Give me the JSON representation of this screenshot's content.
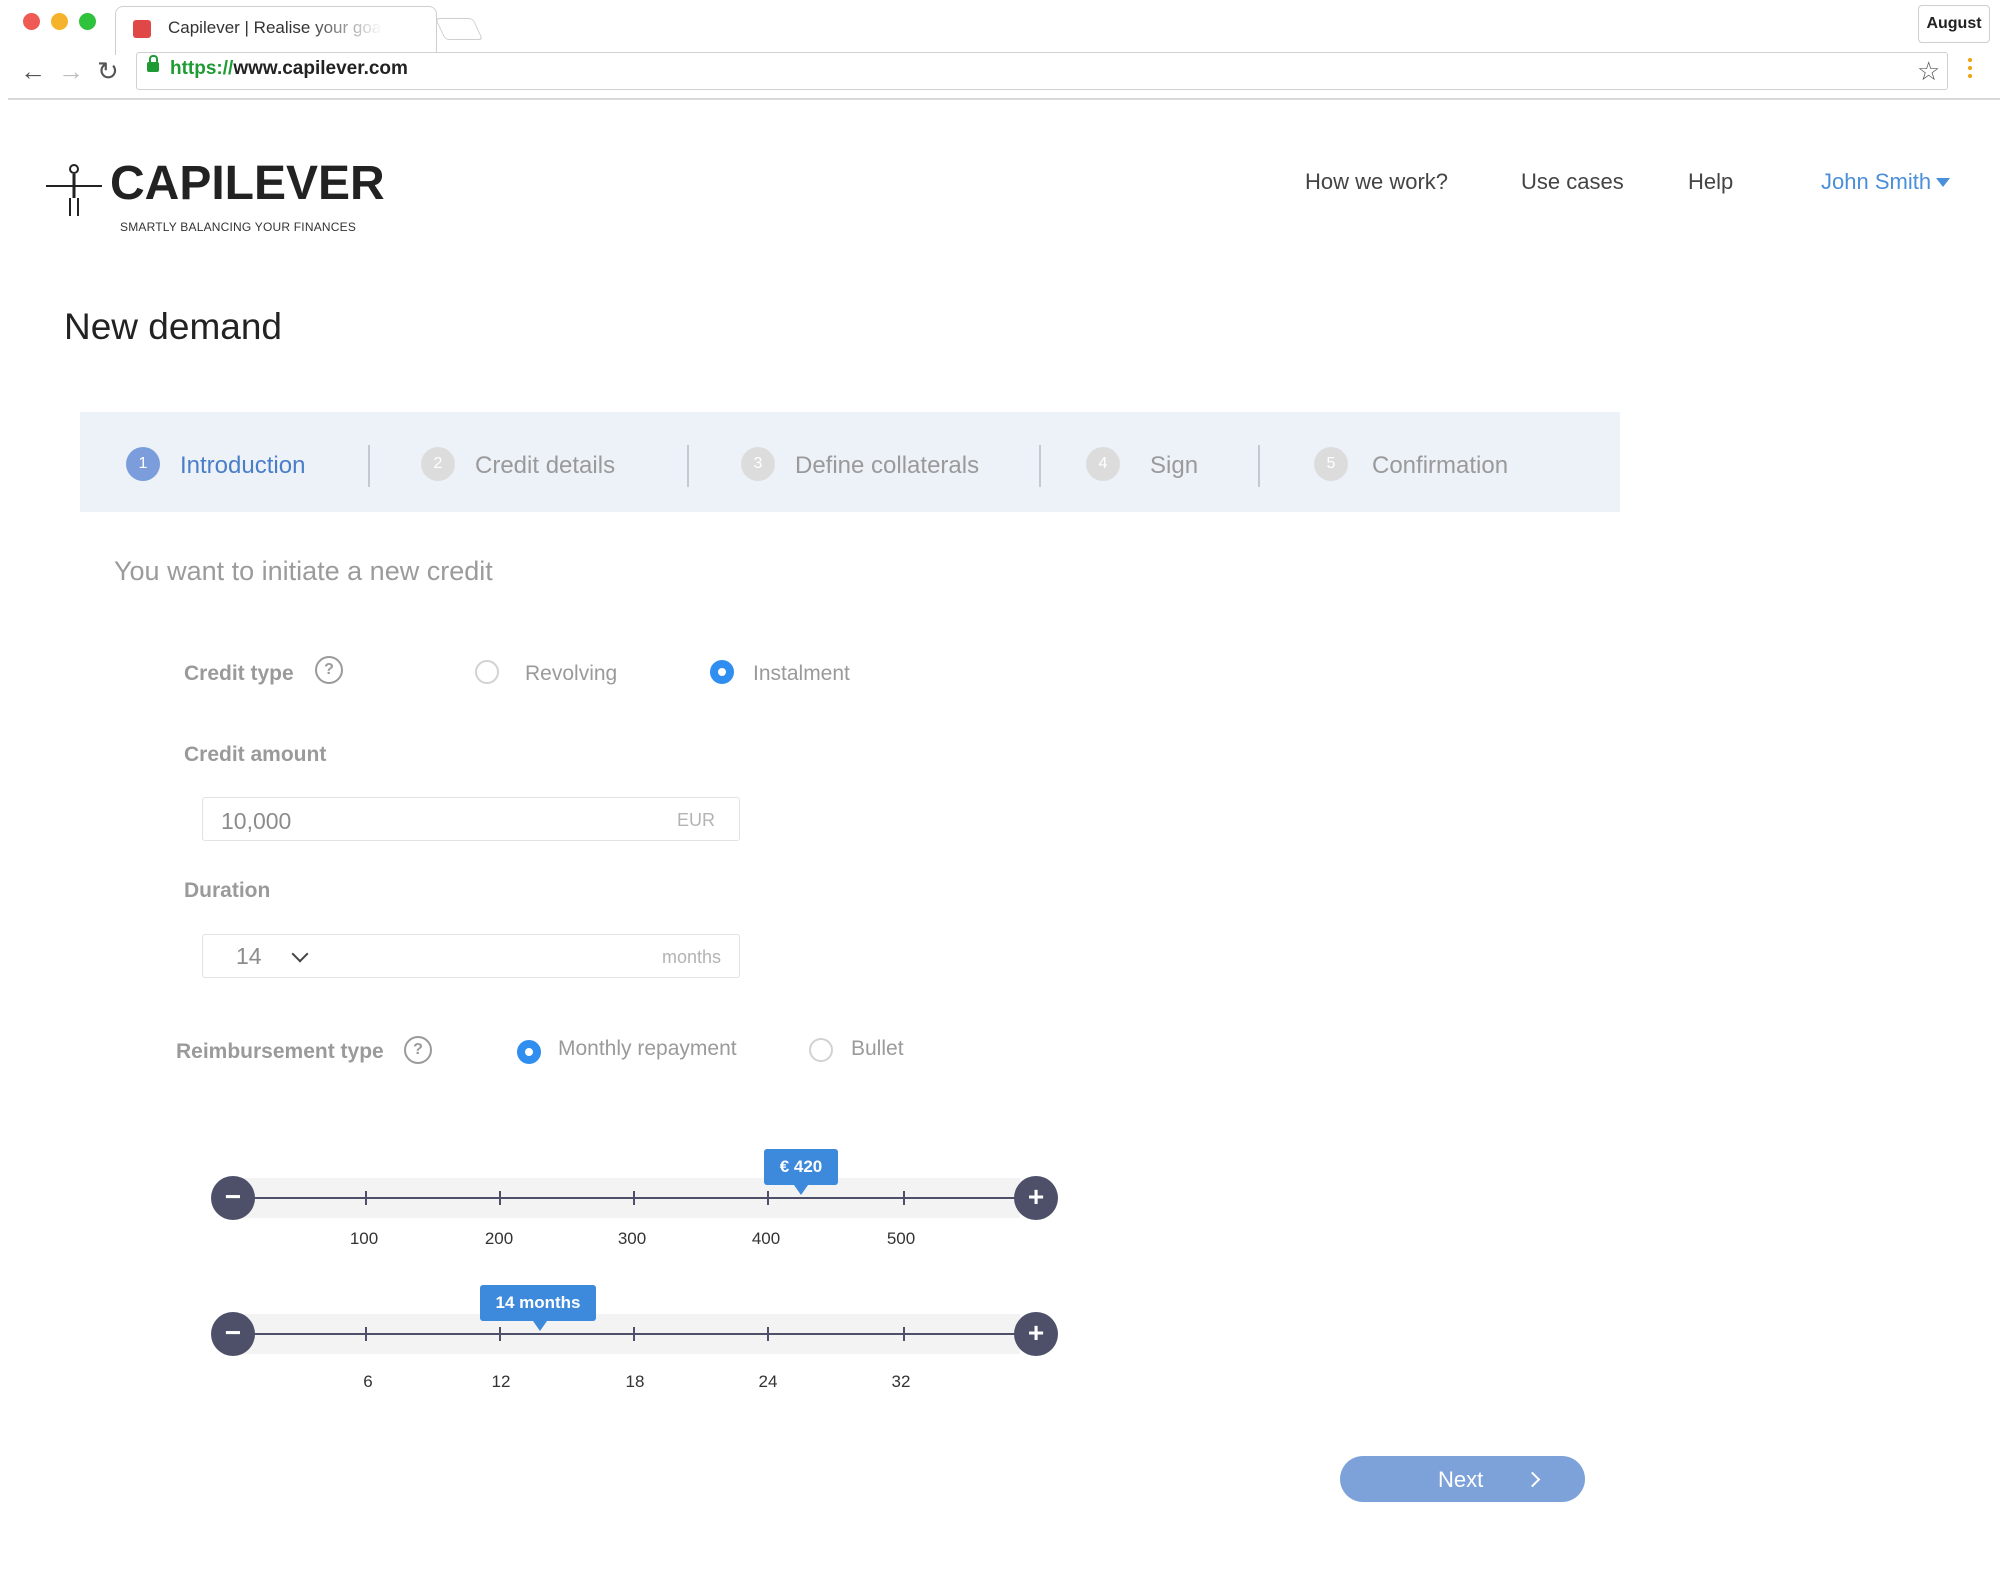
{
  "browser": {
    "tab_title": "Capilever | Realise your goa",
    "url_scheme": "https://",
    "url_host": "www.capilever.com",
    "profile_label": "August",
    "traffic_lights": [
      "#ef5a54",
      "#f5b32b",
      "#2fc23c"
    ]
  },
  "header": {
    "logo_text": "CAPILEVER",
    "logo_tagline": "SMARTLY BALANCING YOUR FINANCES",
    "nav": [
      "How we work?",
      "Use cases",
      "Help"
    ],
    "user_name": "John Smith",
    "accent_color": "#4a8fd9"
  },
  "page": {
    "title": "New demand",
    "subtitle": "You want to initiate a new credit"
  },
  "stepper": {
    "steps": [
      {
        "number": "1",
        "label": "Introduction",
        "active": true
      },
      {
        "number": "2",
        "label": "Credit details",
        "active": false
      },
      {
        "number": "3",
        "label": "Define collaterals",
        "active": false
      },
      {
        "number": "4",
        "label": "Sign",
        "active": false
      },
      {
        "number": "5",
        "label": "Confirmation",
        "active": false
      }
    ]
  },
  "form": {
    "credit_type": {
      "label": "Credit type",
      "help": "?",
      "options": [
        "Revolving",
        "Instalment"
      ],
      "selected": "Instalment"
    },
    "credit_amount": {
      "label": "Credit amount",
      "value": "10,000",
      "unit": "EUR"
    },
    "duration": {
      "label": "Duration",
      "value": "14",
      "unit": "months"
    },
    "reimbursement_type": {
      "label": "Reimbursement type",
      "help": "?",
      "options": [
        "Monthly repayment",
        "Bullet"
      ],
      "selected": "Monthly repayment"
    }
  },
  "sliders": {
    "repayment": {
      "tooltip": "€ 420",
      "value": 420,
      "ticks": [
        "100",
        "200",
        "300",
        "400",
        "500"
      ],
      "minus": "−",
      "plus": "+"
    },
    "months": {
      "tooltip": "14 months",
      "value": 14,
      "ticks": [
        "6",
        "12",
        "18",
        "24",
        "32"
      ],
      "minus": "−",
      "plus": "+"
    }
  },
  "actions": {
    "next_label": "Next"
  }
}
